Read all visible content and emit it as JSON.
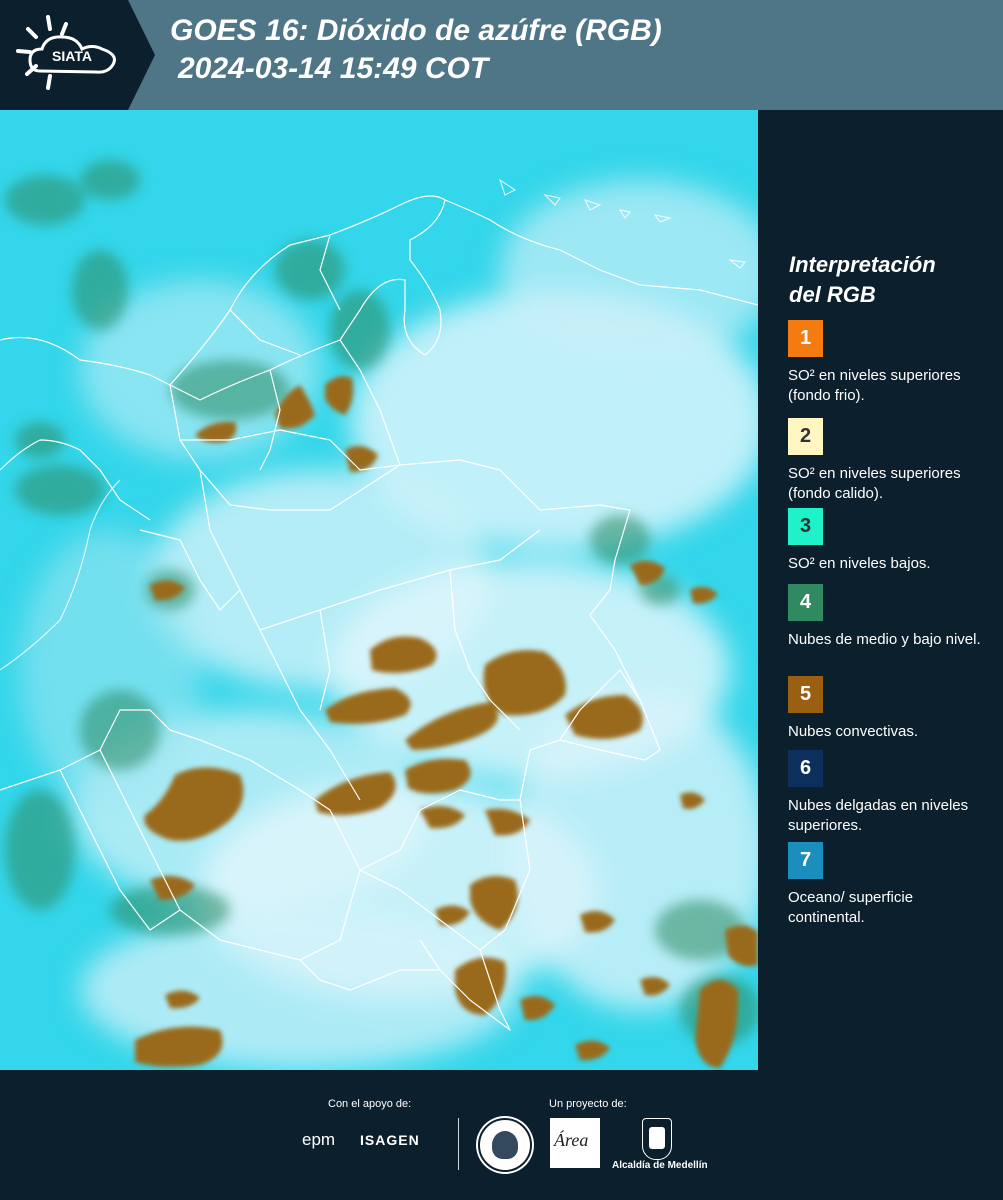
{
  "header": {
    "title_line1": "GOES 16: Dióxido de azúfre (RGB)",
    "title_line2": "2024-03-14 15:49 COT",
    "logo_text": "SIATA"
  },
  "legend": {
    "title_line1": "Interpretación",
    "title_line2": "del RGB",
    "items": [
      {
        "number": "1",
        "color": "#f47b10",
        "text_color": "#ffffff",
        "label": "SO² en niveles superiores (fondo frio)."
      },
      {
        "number": "2",
        "color": "#fff6c2",
        "text_color": "#333333",
        "label": "SO² en niveles superiores (fondo calido)."
      },
      {
        "number": "3",
        "color": "#1ff2c8",
        "text_color": "#333333",
        "label": "SO² en niveles bajos."
      },
      {
        "number": "4",
        "color": "#2f8a62",
        "text_color": "#ffffff",
        "label": "Nubes de medio y bajo nivel."
      },
      {
        "number": "5",
        "color": "#9a5f10",
        "text_color": "#ffffff",
        "label": "Nubes convectivas."
      },
      {
        "number": "6",
        "color": "#0c2f5c",
        "text_color": "#ffffff",
        "label": "Nubes delgadas en niveles superiores."
      },
      {
        "number": "7",
        "color": "#1a8fbd",
        "text_color": "#ffffff",
        "label": "Oceano/ superficie continental."
      }
    ]
  },
  "footer": {
    "support_label": "Con el apoyo de:",
    "project_label": "Un proyecto de:",
    "sponsor1": "epm",
    "sponsor2": "ISAGEN",
    "partner_area_logo": "Área",
    "partner_alcaldia": "Alcaldía de Medellín"
  },
  "colors": {
    "header_bg": "#4e7686",
    "panel_bg": "#0b1f2c",
    "map_background": "#33d6ea",
    "haze": "#d9f4fb",
    "convective": "#9a6a1a",
    "mid_low": "#2f8a62"
  }
}
